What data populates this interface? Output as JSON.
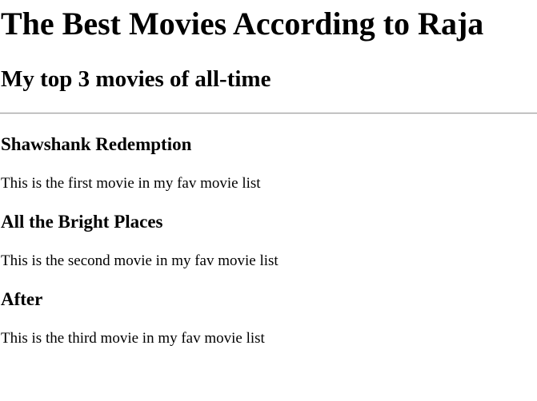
{
  "page": {
    "title": "The Best Movies According to Raja",
    "subtitle": "My top 3 movies of all-time"
  },
  "movies": [
    {
      "title": "Shawshank Redemption",
      "description": "This is the first movie in my fav movie list"
    },
    {
      "title": "All the Bright Places",
      "description": "This is the second movie in my fav movie list"
    },
    {
      "title": "After",
      "description": "This is the third movie in my fav movie list"
    }
  ]
}
